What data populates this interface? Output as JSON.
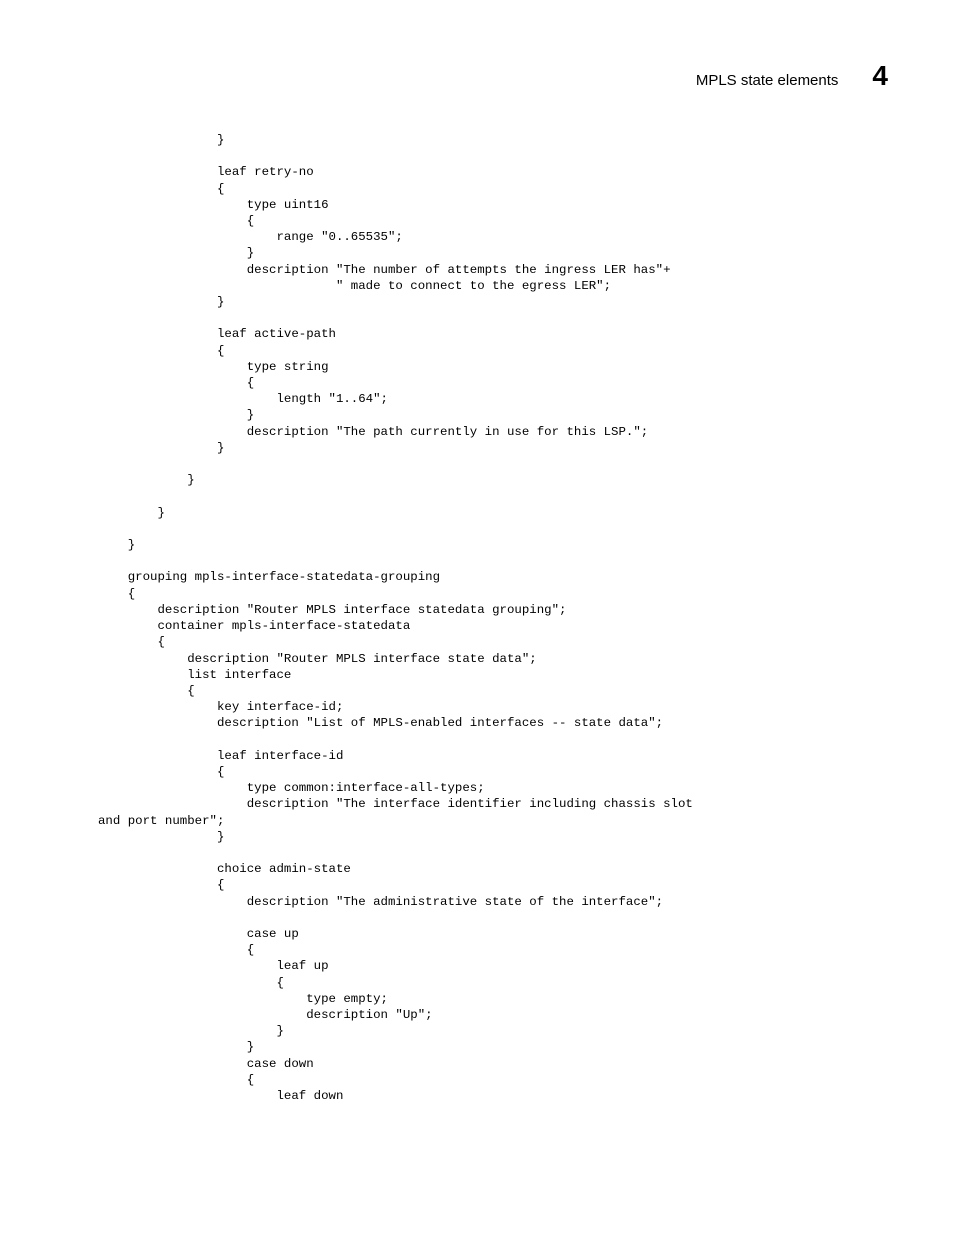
{
  "header": {
    "title": "MPLS state elements",
    "section_number": "4"
  },
  "code": "                }\n\n                leaf retry-no\n                {\n                    type uint16\n                    {\n                        range \"0..65535\";\n                    }\n                    description \"The number of attempts the ingress LER has\"+\n                                \" made to connect to the egress LER\";\n                }\n\n                leaf active-path\n                {\n                    type string\n                    {\n                        length \"1..64\";\n                    }\n                    description \"The path currently in use for this LSP.\";\n                }\n\n            }\n\n        }\n\n    }\n\n    grouping mpls-interface-statedata-grouping\n    {\n        description \"Router MPLS interface statedata grouping\";\n        container mpls-interface-statedata\n        {\n            description \"Router MPLS interface state data\";\n            list interface\n            {\n                key interface-id;\n                description \"List of MPLS-enabled interfaces -- state data\";\n\n                leaf interface-id\n                {\n                    type common:interface-all-types;\n                    description \"The interface identifier including chassis slot \nand port number\";\n                }\n\n                choice admin-state\n                {\n                    description \"The administrative state of the interface\";\n\n                    case up\n                    {\n                        leaf up\n                        {\n                            type empty;\n                            description \"Up\";\n                        }\n                    }\n                    case down\n                    {\n                        leaf down"
}
